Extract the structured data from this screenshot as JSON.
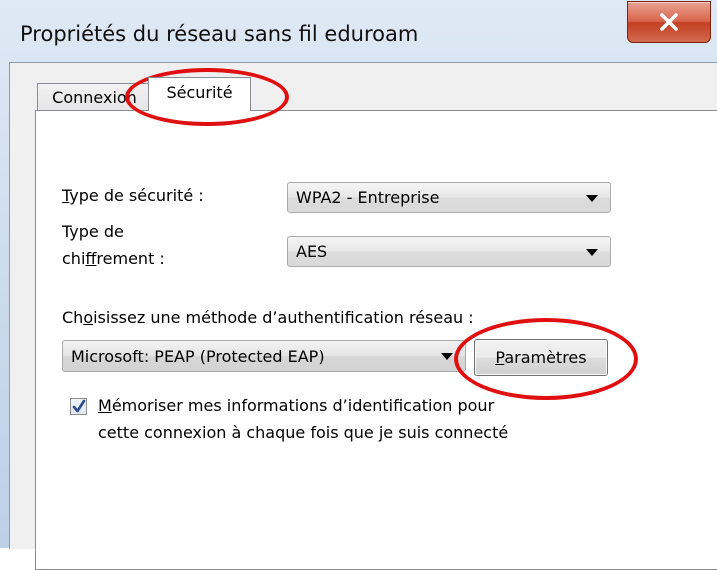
{
  "window": {
    "title": "Propriétés du réseau sans fil eduroam",
    "close_icon": "close-x-icon"
  },
  "tabs": [
    {
      "label": "Connexion",
      "selected": false
    },
    {
      "label": "Sécurité",
      "selected": true
    }
  ],
  "security": {
    "type_label_pre": "",
    "type_label_mnemonic": "T",
    "type_label_post": "ype de sécurité :",
    "type_value": "WPA2 - Entreprise",
    "cipher_label_line1": "Type de",
    "cipher_label_line2_pre": "chi",
    "cipher_label_line2_mnemonic": "f",
    "cipher_label_line2_post": "frement :",
    "cipher_value": "AES",
    "auth_label_pre": "Ch",
    "auth_label_mnemonic": "o",
    "auth_label_post": "isissez une méthode d’authentification réseau :",
    "auth_value": "Microsoft: PEAP (Protected EAP)",
    "settings_button_mnemonic": "P",
    "settings_button_rest": "aramètres",
    "remember_checked": true,
    "remember_line1_mnemonic": "M",
    "remember_line1_rest": "émoriser mes informations d’identification pour",
    "remember_line2": "cette connexion à chaque fois que je suis connecté"
  },
  "colors": {
    "highlight_ring": "#e01010",
    "close_button": "#c33f22"
  }
}
